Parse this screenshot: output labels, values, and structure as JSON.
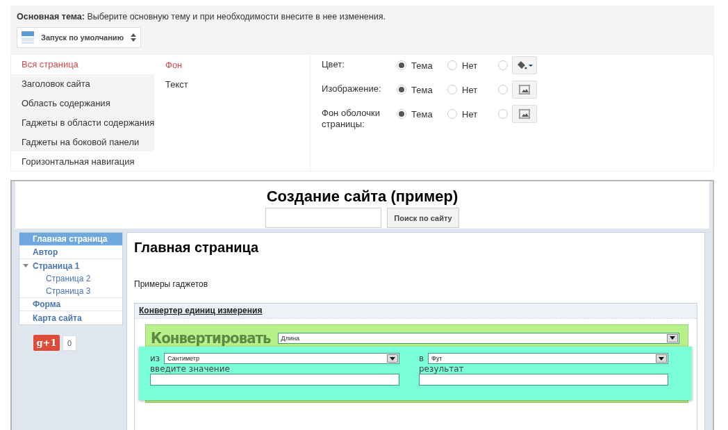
{
  "theme": {
    "label": "Основная тема:",
    "description": "Выберите основную тему и при необходимости внесите в нее изменения.",
    "dropdown": "Запуск по умолчанию"
  },
  "sections": [
    {
      "label": "Вся страница",
      "selected": true
    },
    {
      "label": "Заголовок сайта",
      "selected": false
    },
    {
      "label": "Область содержания",
      "selected": false
    },
    {
      "label": "Гаджеты в области содержания",
      "selected": false
    },
    {
      "label": "Гаджеты на боковой панели",
      "selected": false
    },
    {
      "label": "Горизонтальная навигация",
      "selected": false
    }
  ],
  "subsections": [
    {
      "label": "Фон",
      "selected": true
    },
    {
      "label": "Текст",
      "selected": false
    }
  ],
  "properties": [
    {
      "label": "Цвет:",
      "kind": "color",
      "options": [
        {
          "label": "Тема",
          "selected": true
        },
        {
          "label": "Нет",
          "selected": false
        },
        {
          "selected": false
        }
      ]
    },
    {
      "label": "Изображение:",
      "kind": "image",
      "options": [
        {
          "label": "Тема",
          "selected": true
        },
        {
          "label": "Нет",
          "selected": false
        },
        {
          "selected": false
        }
      ]
    },
    {
      "label": "Фон оболочки страницы:",
      "kind": "image",
      "options": [
        {
          "label": "Тема",
          "selected": true
        },
        {
          "label": "Нет",
          "selected": false
        },
        {
          "selected": false
        }
      ]
    }
  ],
  "preview": {
    "site_title": "Создание сайта (пример)",
    "search_button": "Поиск по сайту",
    "nav": [
      {
        "label": "Главная страница",
        "selected": true
      },
      {
        "label": "Автор",
        "selected": false
      },
      {
        "label": "Страница 1",
        "selected": false,
        "expanded": true,
        "children": [
          {
            "label": "Страница 2",
            "selected": false
          },
          {
            "label": "Страница 3",
            "selected": false
          }
        ]
      },
      {
        "label": "Форма",
        "selected": false
      },
      {
        "label": "Карта сайта",
        "selected": false
      }
    ],
    "plusone": {
      "label": "g+1",
      "count": "0"
    },
    "page_title": "Главная страница",
    "intro": "Примеры гаджетов",
    "gadget": {
      "title": "Конвертер единиц измерения",
      "heading": "Конвертировать",
      "category": "Длина",
      "from_label": "из",
      "from": "Сантиметр",
      "to_label": "в",
      "to": "Фут",
      "input_label": "введите значение",
      "result_label": "результат"
    }
  }
}
